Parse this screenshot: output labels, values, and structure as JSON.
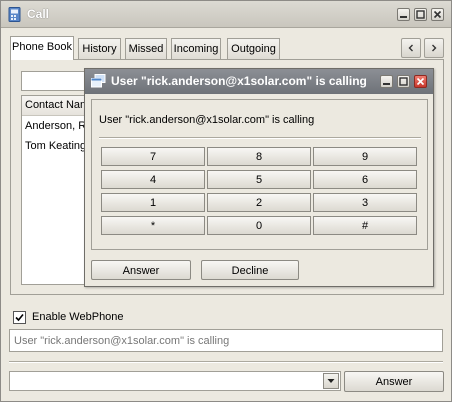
{
  "window": {
    "title": "Call",
    "title_icon": "phone-book-icon"
  },
  "tabs": [
    {
      "label": "Phone Book",
      "active": true
    },
    {
      "label": "History",
      "active": false
    },
    {
      "label": "Missed",
      "active": false
    },
    {
      "label": "Incoming",
      "active": false
    },
    {
      "label": "Outgoing",
      "active": false
    }
  ],
  "contacts": {
    "column_header": "Contact Name",
    "rows": [
      "Anderson, Rick",
      "Tom Keating"
    ]
  },
  "dialog": {
    "title": "User \"rick.anderson@x1solar.com\" is calling",
    "message": "User \"rick.anderson@x1solar.com\" is calling",
    "keypad": [
      [
        "7",
        "8",
        "9"
      ],
      [
        "4",
        "5",
        "6"
      ],
      [
        "1",
        "2",
        "3"
      ],
      [
        "*",
        "0",
        "#"
      ]
    ],
    "answer_label": "Answer",
    "decline_label": "Decline"
  },
  "webphone": {
    "enable_label": "Enable WebPhone",
    "checked": true
  },
  "status_text": "User \"rick.anderson@x1solar.com\" is calling",
  "dial": {
    "value": "",
    "answer_label": "Answer"
  },
  "colors": {
    "dialog_title_bg": "#7d8086",
    "close_button": "#d9443a",
    "title_text": "#ffffff"
  }
}
